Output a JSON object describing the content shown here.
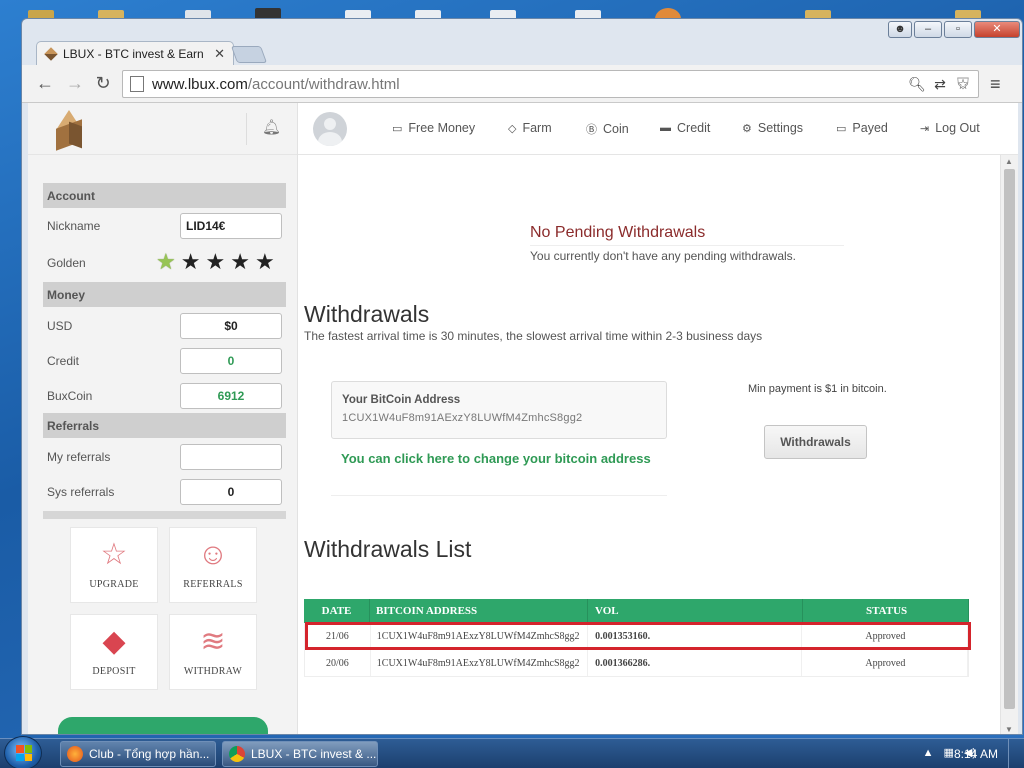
{
  "browser": {
    "tab_title": "LBUX - BTC invest & Earn",
    "tab_close": "✕",
    "url_domain": "www.lbux.com",
    "url_path": "/account/withdraw.html"
  },
  "sidebar": {
    "account_header": "Account",
    "nickname_label": "Nickname",
    "nickname_value": "LID14€",
    "golden_label": "Golden",
    "golden_stars": "1 of 5",
    "money_header": "Money",
    "usd_label": "USD",
    "usd_value": "$0",
    "credit_label": "Credit",
    "credit_value": "0",
    "buxcoin_label": "BuxCoin",
    "buxcoin_value": "6912",
    "referrals_header": "Referrals",
    "my_referrals_label": "My referrals",
    "my_referrals_value": "",
    "sys_referrals_label": "Sys referrals",
    "sys_referrals_value": "0",
    "tiles": [
      "UPGRADE",
      "REFERRALS",
      "DEPOSIT",
      "WITHDRAW"
    ]
  },
  "topnav": {
    "items": [
      "Free Money",
      "Farm",
      "Coin",
      "Credit",
      "Settings",
      "Payed",
      "Log Out"
    ]
  },
  "main": {
    "pending_title": "No Pending Withdrawals",
    "pending_sub": "You currently don't have any pending withdrawals.",
    "withdrawals_heading": "Withdrawals",
    "withdrawals_sub": "The fastest arrival time is 30 minutes, the slowest arrival time within 2-3 business days",
    "address_title": "Your BitCoin Address",
    "address_value": "1CUX1W4uF8m91AExzY8LUWfM4ZmhcS8gg2",
    "change_link": "You can click here to change your bitcoin address",
    "min_payment": "Min payment is $1 in bitcoin.",
    "withdraw_button": "Withdrawals",
    "list_heading": "Withdrawals List",
    "table": {
      "headers": [
        "DATE",
        "BITCOIN ADDRESS",
        "VOL",
        "STATUS"
      ],
      "rows": [
        [
          "21/06",
          "1CUX1W4uF8m91AExzY8LUWfM4ZmhcS8gg2",
          "0.001353160.",
          "Approved"
        ],
        [
          "20/06",
          "1CUX1W4uF8m91AExzY8LUWfM4ZmhcS8gg2",
          "0.001366286.",
          "Approved"
        ]
      ]
    }
  },
  "taskbar": {
    "tasks": [
      "Club - Tổng hợp hần...",
      "LBUX - BTC invest & ..."
    ],
    "clock": "8:14 AM"
  },
  "colors": {
    "accent_green": "#2ea76b",
    "pending_red": "#8b2b2b",
    "highlight_red": "#d4242c"
  }
}
